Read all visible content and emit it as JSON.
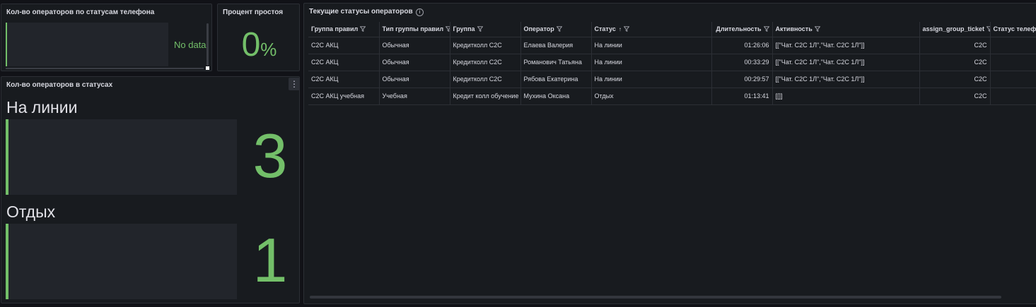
{
  "panel_phone_status": {
    "title": "Кол-во операторов по статусам телефона",
    "no_data": "No data"
  },
  "panel_idle": {
    "title": "Процент простоя",
    "value": "0",
    "unit": "%"
  },
  "panel_statuses": {
    "title": "Кол-во операторов в статусах",
    "menu_icon": "⋮",
    "items": [
      {
        "label": "На линии",
        "value": "3"
      },
      {
        "label": "Отдых",
        "value": "1"
      }
    ]
  },
  "panel_table": {
    "title": "Текущие статусы операторов",
    "info_icon": "i",
    "columns": [
      {
        "label": "Группа правил"
      },
      {
        "label": "Тип группы правил"
      },
      {
        "label": "Группа"
      },
      {
        "label": "Оператор"
      },
      {
        "label": "Статус",
        "sort": "↑"
      },
      {
        "label": "Длительность"
      },
      {
        "label": "Активность"
      },
      {
        "label": "assign_group_ticket"
      },
      {
        "label": "Статус телефона"
      }
    ],
    "rows": [
      {
        "c0": "C2C АКЦ",
        "c1": "Обычная",
        "c2": "Кредитколл C2C",
        "c3": "Елаева Валерия",
        "c4": "На линии",
        "c5": "01:26:06",
        "c6": "[[\"Чат. C2C 1Л\",\"Чат. C2C 1Л\"]]",
        "c7": "C2C",
        "c8": ""
      },
      {
        "c0": "C2C АКЦ",
        "c1": "Обычная",
        "c2": "Кредитколл C2C",
        "c3": "Романович Татьяна",
        "c4": "На линии",
        "c5": "00:33:29",
        "c6": "[[\"Чат. C2C 1Л\",\"Чат. C2C 1Л\"]]",
        "c7": "C2C",
        "c8": ""
      },
      {
        "c0": "C2C АКЦ",
        "c1": "Обычная",
        "c2": "Кредитколл C2C",
        "c3": "Рябова Екатерина",
        "c4": "На линии",
        "c5": "00:29:57",
        "c6": "[[\"Чат. C2C 1Л\",\"Чат. C2C 1Л\"]]",
        "c7": "C2C",
        "c8": ""
      },
      {
        "c0": "C2C АКЦ учебная",
        "c1": "Учебная",
        "c2": "Кредит колл обучение",
        "c3": "Мухина Оксана",
        "c4": "Отдых",
        "c5": "01:13:41",
        "c6": "[[]]",
        "c7": "C2C",
        "c8": ""
      }
    ]
  },
  "colors": {
    "accent": "#73bf69",
    "panel_bg": "#181b1f",
    "page_bg": "#111217",
    "border": "#2c2f35"
  }
}
